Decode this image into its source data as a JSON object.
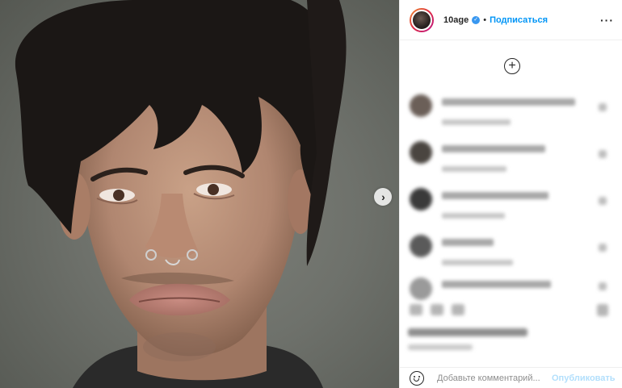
{
  "post": {
    "image_alt": "",
    "next_label": "›"
  },
  "header": {
    "username": "10age",
    "verified_mark": "✓",
    "separator": "•",
    "follow_label": "Подписаться",
    "more_label": "···"
  },
  "load_more_label": "+",
  "comments": [
    {
      "blurred": true,
      "avatar_color": "#6b5f58"
    },
    {
      "blurred": true,
      "avatar_color": "#4a4540"
    },
    {
      "blurred": true,
      "avatar_color": "#3a3a3a"
    },
    {
      "blurred": true,
      "avatar_color": "#5a5a5a"
    },
    {
      "blurred": true,
      "avatar_color": "#9a9a9a"
    }
  ],
  "add_comment": {
    "placeholder": "Добавьте комментарий...",
    "publish_label": "Опубликовать"
  },
  "colors": {
    "accent": "#0095f6",
    "verified": "#3897f0",
    "publish_disabled": "#b2dffc",
    "border": "#efefef"
  }
}
